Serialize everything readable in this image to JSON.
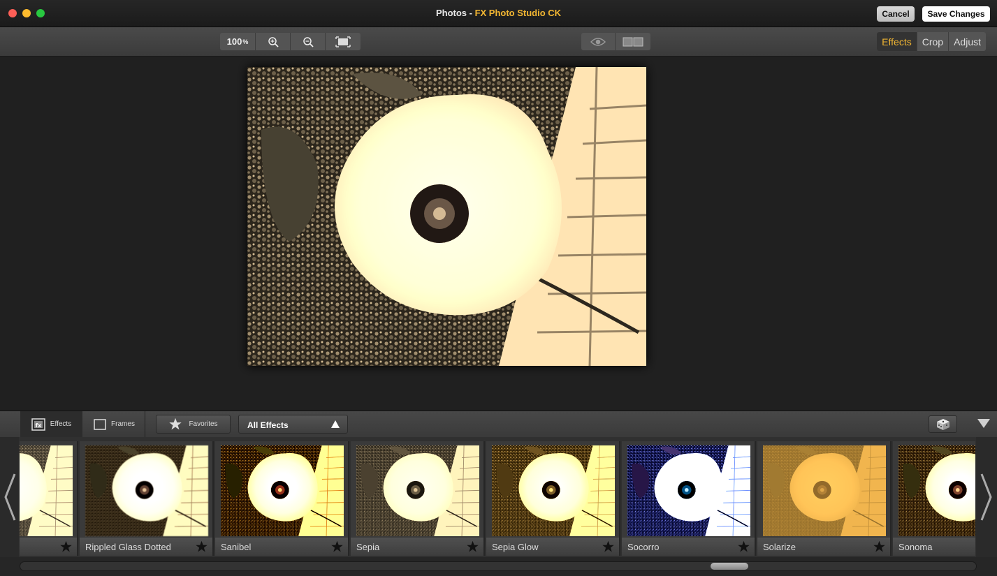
{
  "window": {
    "title_prefix": "Photos - ",
    "title_plugin": "FX Photo Studio CK",
    "cancel_label": "Cancel",
    "save_label": "Save Changes"
  },
  "toolbar": {
    "zoom_value": "100",
    "zoom_unit": "%",
    "modes": [
      "Effects",
      "Crop",
      "Adjust"
    ],
    "active_mode": "Effects"
  },
  "bottom": {
    "tab_effects": "Effects",
    "tab_frames": "Frames",
    "favorites_label": "Favorites",
    "filter_value": "All Effects"
  },
  "effects": [
    {
      "label": "",
      "filter": "sepia"
    },
    {
      "label": "Rippled Glass Dotted",
      "filter": "rippled"
    },
    {
      "label": "Sanibel",
      "filter": "sanibel"
    },
    {
      "label": "Sepia",
      "filter": "sepia"
    },
    {
      "label": "Sepia Glow",
      "filter": "glow"
    },
    {
      "label": "Socorro",
      "filter": "socorro"
    },
    {
      "label": "Solarize",
      "filter": "solarize"
    },
    {
      "label": "Sonoma",
      "filter": "sonoma"
    }
  ],
  "colors": {
    "accent": "#f2b632",
    "background": "#1e1e1e"
  }
}
